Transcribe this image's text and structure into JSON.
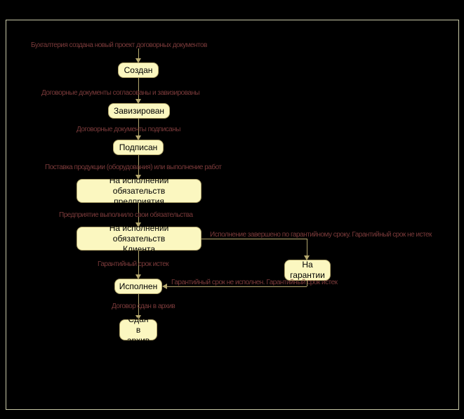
{
  "chart_data": {
    "type": "diagram",
    "title": "",
    "nodes": [
      {
        "id": "n1",
        "label": "Создан"
      },
      {
        "id": "n2",
        "label": "Завизирован"
      },
      {
        "id": "n3",
        "label": "Подписан"
      },
      {
        "id": "n4",
        "label": "На исполнении обязательств\nпредприятия"
      },
      {
        "id": "n5",
        "label": "На исполнении обязательств\nКлиента"
      },
      {
        "id": "n6",
        "label": "Исполнен"
      },
      {
        "id": "n7",
        "label": "Сдан в\nархив"
      },
      {
        "id": "n8",
        "label": "На\nгарантии"
      }
    ],
    "edges": [
      {
        "from": "start",
        "to": "n1",
        "label": "Бухгалтерия создана новый проект договорных документов"
      },
      {
        "from": "n1",
        "to": "n2",
        "label": "Договорные документы согласованы и завизированы"
      },
      {
        "from": "n2",
        "to": "n3",
        "label": "Договорные документы подписаны"
      },
      {
        "from": "n3",
        "to": "n4",
        "label": "Поставка продукции (оборудования) или выполнение работ"
      },
      {
        "from": "n4",
        "to": "n5",
        "label": "Предприятие выполнило свои обязательства"
      },
      {
        "from": "n5",
        "to": "n6",
        "label": "Гарантийный срок истек"
      },
      {
        "from": "n5",
        "to": "n8",
        "label": "Исполнение завершено по гарантийному сроку. Гарантийный срок не истек"
      },
      {
        "from": "n6",
        "to": "n7",
        "label": "Договор сдан в архив"
      },
      {
        "from": "n8",
        "to": "n6",
        "label": "Гарантийный срок не исполнен. Гарантийный срок истек"
      }
    ]
  },
  "nodes": {
    "n1": "Создан",
    "n2": "Завизирован",
    "n3": "Подписан",
    "n4": "На исполнении обязательств\nпредприятия",
    "n5": "На исполнении обязательств\nКлиента",
    "n6": "Исполнен",
    "n7": "Сдан в\nархив",
    "n8": "На\nгарантии"
  },
  "labels": {
    "l0": "Бухгалтерия создана новый проект договорных документов",
    "l1": "Договорные документы согласованы и завизированы",
    "l2": "Договорные документы подписаны",
    "l3": "Поставка продукции (оборудования) или выполнение работ",
    "l4": "Предприятие выполнило свои обязательства",
    "l5": "Гарантийный срок истек",
    "l5b": "Исполнение завершено по гарантийному сроку. Гарантийный срок не истек",
    "l6": "Гарантийный срок не исполнен. Гарантийный срок истек",
    "l7": "Договор сдан в архив"
  }
}
